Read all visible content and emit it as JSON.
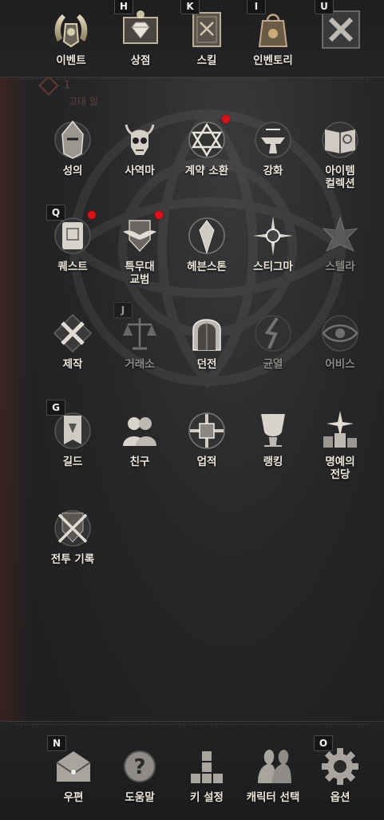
{
  "colors": {
    "accent_red": "#e0101a",
    "label": "#ece6da",
    "label_dim": "#8d8a85",
    "key_bg": "#161616"
  },
  "top_menu": [
    {
      "label": "이벤트",
      "icon": "event-laurel-icon",
      "key": ""
    },
    {
      "label": "상점",
      "icon": "shop-diamond-icon",
      "key": "H"
    },
    {
      "label": "스킬",
      "icon": "skill-book-icon",
      "key": "K"
    },
    {
      "label": "인벤토리",
      "icon": "inventory-bag-icon",
      "key": "I"
    },
    {
      "label": "",
      "icon": "close-menu-icon",
      "key": "U"
    }
  ],
  "background": {
    "faded_text_1": "1",
    "faded_text_2": "고대 일"
  },
  "grid": [
    {
      "label": "성의",
      "icon": "helmet-icon",
      "key": "",
      "dot": false,
      "dim": false
    },
    {
      "label": "사역마",
      "icon": "horned-skull-icon",
      "key": "",
      "dot": false,
      "dim": false
    },
    {
      "label": "계약 소환",
      "icon": "hexagram-icon",
      "key": "",
      "dot": true,
      "dim": false
    },
    {
      "label": "강화",
      "icon": "anvil-icon",
      "key": "",
      "dot": false,
      "dim": false
    },
    {
      "label": "아이템\n컬렉션",
      "icon": "collection-book-icon",
      "key": "",
      "dot": false,
      "dim": false
    },
    {
      "label": "퀘스트",
      "icon": "quest-scroll-icon",
      "key": "Q",
      "dot": true,
      "dim": false
    },
    {
      "label": "특무대\n교범",
      "icon": "winged-shield-icon",
      "key": "",
      "dot": true,
      "dim": false
    },
    {
      "label": "헤븐스톤",
      "icon": "heavenstone-icon",
      "key": "",
      "dot": false,
      "dim": false
    },
    {
      "label": "스티그마",
      "icon": "stigma-icon",
      "key": "",
      "dot": false,
      "dim": false
    },
    {
      "label": "스텔라",
      "icon": "stella-icon",
      "key": "",
      "dot": false,
      "dim": true
    },
    {
      "label": "제작",
      "icon": "hammer-icon",
      "key": "",
      "dot": false,
      "dim": false
    },
    {
      "label": "거래소",
      "icon": "scales-icon",
      "key": "J",
      "dot": false,
      "dim": true
    },
    {
      "label": "던전",
      "icon": "dungeon-gate-icon",
      "key": "",
      "dot": false,
      "dim": false
    },
    {
      "label": "균열",
      "icon": "rift-icon",
      "key": "",
      "dot": false,
      "dim": true
    },
    {
      "label": "어비스",
      "icon": "abyss-eye-icon",
      "key": "",
      "dot": false,
      "dim": true
    },
    {
      "label": "길드",
      "icon": "guild-banner-icon",
      "key": "G",
      "dot": false,
      "dim": false
    },
    {
      "label": "친구",
      "icon": "friends-icon",
      "key": "",
      "dot": false,
      "dim": false
    },
    {
      "label": "업적",
      "icon": "achievement-icon",
      "key": "",
      "dot": false,
      "dim": false
    },
    {
      "label": "랭킹",
      "icon": "trophy-icon",
      "key": "",
      "dot": false,
      "dim": false
    },
    {
      "label": "명예의\n전당",
      "icon": "hall-of-fame-icon",
      "key": "",
      "dot": false,
      "dim": false
    },
    {
      "label": "전투 기록",
      "icon": "crossed-swords-icon",
      "key": "",
      "dot": false,
      "dim": false
    }
  ],
  "bottom_menu": [
    {
      "label": "우편",
      "icon": "mail-icon",
      "key": "N"
    },
    {
      "label": "도움말",
      "icon": "help-icon",
      "key": ""
    },
    {
      "label": "키 설정",
      "icon": "key-settings-icon",
      "key": ""
    },
    {
      "label": "캐릭터 선택",
      "icon": "character-select-icon",
      "key": ""
    },
    {
      "label": "옵션",
      "icon": "gear-icon",
      "key": "O"
    }
  ]
}
